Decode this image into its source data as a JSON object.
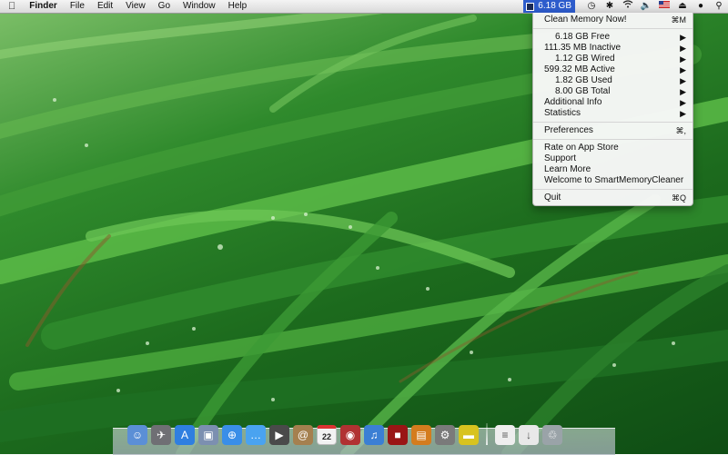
{
  "menubar": {
    "app_name": "Finder",
    "menus": [
      "File",
      "Edit",
      "View",
      "Go",
      "Window",
      "Help"
    ],
    "memory_readout": "6.18 GB"
  },
  "status_icons": [
    "time-machine-icon",
    "bluetooth-icon",
    "wifi-icon",
    "volume-icon",
    "us-flag-icon",
    "eject-icon",
    "user-icon",
    "spotlight-icon"
  ],
  "dropdown": {
    "clean": {
      "label": "Clean Memory Now!",
      "shortcut": "⌘M"
    },
    "stats": [
      {
        "label": "6.18 GB Free"
      },
      {
        "label": "111.35 MB Inactive"
      },
      {
        "label": "1.12 GB Wired"
      },
      {
        "label": "599.32 MB Active"
      },
      {
        "label": "1.82 GB Used"
      },
      {
        "label": "8.00 GB Total"
      },
      {
        "label": "Additional Info"
      },
      {
        "label": "Statistics"
      }
    ],
    "preferences": {
      "label": "Preferences",
      "shortcut": "⌘,"
    },
    "links": [
      {
        "label": "Rate on App Store"
      },
      {
        "label": "Support"
      },
      {
        "label": "Learn More"
      },
      {
        "label": "Welcome to SmartMemoryCleaner"
      }
    ],
    "quit": {
      "label": "Quit",
      "shortcut": "⌘Q"
    }
  },
  "dock": {
    "calendar_day": "22",
    "apps": [
      {
        "name": "finder-icon",
        "color": "#5b8fd6"
      },
      {
        "name": "launchpad-icon",
        "color": "#6f6f74"
      },
      {
        "name": "app-store-icon",
        "color": "#2f7fe0"
      },
      {
        "name": "preview-icon",
        "color": "#7c8fb0"
      },
      {
        "name": "safari-icon",
        "color": "#3a8ee8"
      },
      {
        "name": "messages-icon",
        "color": "#4aa3f0"
      },
      {
        "name": "facetime-icon",
        "color": "#4a4a4a"
      },
      {
        "name": "contacts-icon",
        "color": "#a5804f"
      },
      {
        "name": "calendar-icon",
        "color": "#f2f2f2"
      },
      {
        "name": "photo-booth-icon",
        "color": "#b13232"
      },
      {
        "name": "itunes-icon",
        "color": "#3b7fd4"
      },
      {
        "name": "photo-app-icon",
        "color": "#9a1515"
      },
      {
        "name": "iphoto-icon",
        "color": "#d47c1e"
      },
      {
        "name": "system-preferences-icon",
        "color": "#7a7a7a"
      },
      {
        "name": "memory-cleaner-icon",
        "color": "#d8c31f"
      }
    ],
    "trailing": [
      {
        "name": "document-icon",
        "color": "#eeeeee"
      },
      {
        "name": "downloads-icon",
        "color": "#e8e8e8"
      },
      {
        "name": "trash-icon",
        "color": "#9aa3a8"
      }
    ]
  }
}
